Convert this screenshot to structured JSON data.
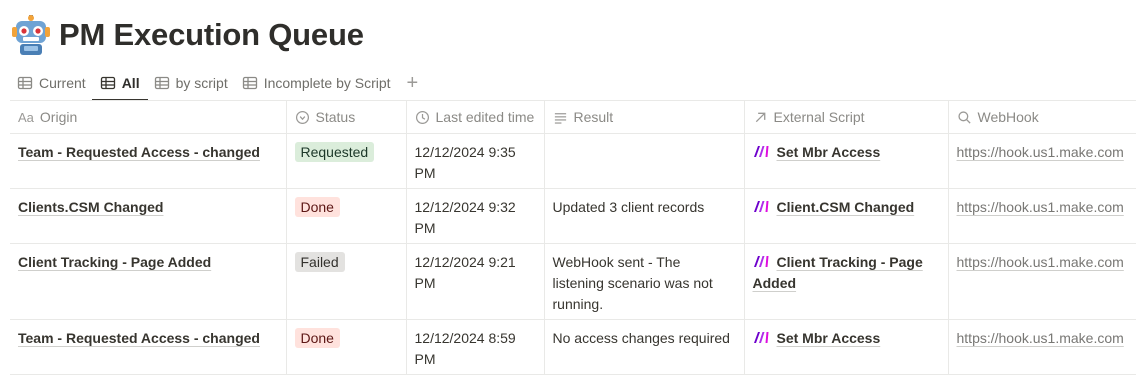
{
  "page": {
    "title": "PM Execution Queue",
    "icon": "robot-emoji-icon"
  },
  "tabs": [
    {
      "label": "Current",
      "icon": "table-icon",
      "active": false
    },
    {
      "label": "All",
      "icon": "table-icon",
      "active": true
    },
    {
      "label": "by script",
      "icon": "table-icon",
      "active": false
    },
    {
      "label": "Incomplete by Script",
      "icon": "table-icon",
      "active": false
    }
  ],
  "columns": {
    "origin": {
      "label": "Origin",
      "icon_text": "Aa"
    },
    "status": {
      "label": "Status",
      "icon": "status-icon"
    },
    "edited": {
      "label": "Last edited time",
      "icon": "clock-icon"
    },
    "result": {
      "label": "Result",
      "icon": "text-lines-icon"
    },
    "script": {
      "label": "External Script",
      "icon": "arrow-up-right-icon"
    },
    "webhook": {
      "label": "WebHook",
      "icon": "search-icon"
    }
  },
  "status_colors": {
    "Requested": "#dbeddb",
    "Done": "#ffe2dd",
    "Failed": "#e3e2e0"
  },
  "rows": [
    {
      "origin": "Team - Requested Access - changed",
      "status": "Requested",
      "time_a": "12/12/2024 9:35",
      "time_b": "PM",
      "result": "",
      "script": "Set Mbr Access",
      "webhook": "https://hook.us1.make.com"
    },
    {
      "origin": "Clients.CSM Changed",
      "status": "Done",
      "time_a": "12/12/2024 9:32",
      "time_b": "PM",
      "result": "Updated 3 client records",
      "script": "Client.CSM Changed",
      "webhook": "https://hook.us1.make.com"
    },
    {
      "origin": "Client Tracking - Page Added",
      "status": "Failed",
      "time_a": "12/12/2024 9:21",
      "time_b": "PM",
      "result": "WebHook sent - The listening scenario was not running.",
      "script": "Client Tracking - Page Added",
      "webhook": "https://hook.us1.make.com"
    },
    {
      "origin": "Team - Requested Access - changed",
      "status": "Done",
      "time_a": "12/12/2024 8:59",
      "time_b": "PM",
      "result": "No access changes required",
      "script": "Set Mbr Access",
      "webhook": "https://hook.us1.make.com"
    }
  ]
}
